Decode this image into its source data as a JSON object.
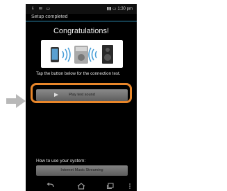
{
  "status_bar": {
    "left_icons": "⇩ ✉ ▭",
    "right_text": "1:30 pm"
  },
  "screen": {
    "title": "Setup completed",
    "headline": "Congratulations!",
    "instruction": "Tap the button below for the connection test.",
    "play_button_label": "Play test sound",
    "how_to_label": "How to use your system:",
    "stream_button_label": "Internet Music Streaming"
  },
  "nav_icons": [
    "back-icon",
    "home-icon",
    "recent-apps-icon",
    "menu-icon"
  ],
  "colors": {
    "highlight": "#e8862a",
    "arrow": "#b8b8b8",
    "title_divider": "#2f8fb8"
  }
}
